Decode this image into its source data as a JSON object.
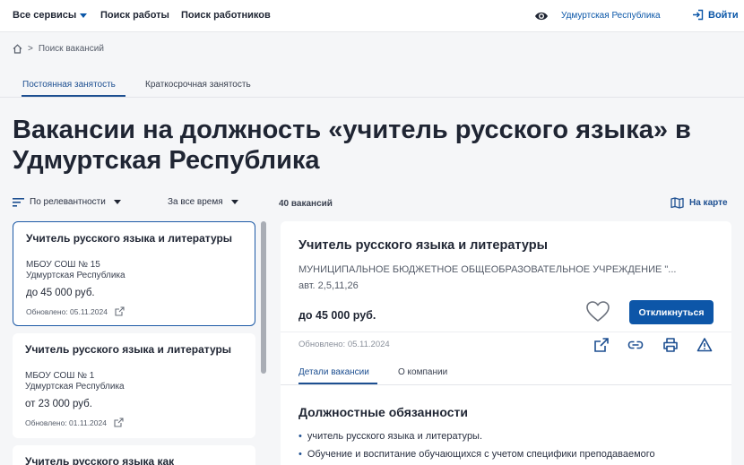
{
  "header": {
    "all_services": "Все сервисы",
    "job_search": "Поиск работы",
    "worker_search": "Поиск работников",
    "region": "Удмуртская Республика",
    "login": "Войти"
  },
  "breadcrumb": {
    "current": "Поиск вакансий"
  },
  "tabs": [
    {
      "label": "Постоянная занятость",
      "active": true
    },
    {
      "label": "Краткосрочная занятость",
      "active": false
    }
  ],
  "page_title": "Вакансии на должность «учитель русского языка» в Удмуртская Республика",
  "filters": {
    "sort": "По релевантности",
    "period": "За все время",
    "count": "40 вакансий",
    "map": "На карте"
  },
  "cards": [
    {
      "title": "Учитель русского языка и литературы",
      "org": "МБОУ СОШ № 15",
      "region": "Удмуртская Республика",
      "salary": "до 45 000 руб.",
      "updated": "Обновлено: 05.11.2024"
    },
    {
      "title": "Учитель русского языка и литературы",
      "org": "МБОУ СОШ № 1",
      "region": "Удмуртская Республика",
      "salary": "от 23 000 руб.",
      "updated": "Обновлено: 01.11.2024"
    },
    {
      "title": "Учитель русского языка как"
    }
  ],
  "detail": {
    "title": "Учитель русского языка и литературы",
    "org": "МУНИЦИПАЛЬНОЕ БЮДЖЕТНОЕ ОБЩЕОБРАЗОВАТЕЛЬНОЕ УЧРЕЖДЕНИЕ \"...",
    "address": "авт. 2,5,11,26",
    "salary": "до 45 000 руб.",
    "apply": "Откликнуться",
    "updated": "Обновлено: 05.11.2024",
    "tabs": [
      {
        "label": "Детали вакансии",
        "active": true
      },
      {
        "label": "О компании",
        "active": false
      }
    ],
    "duties_heading": "Должностные обязанности",
    "duties": [
      "учитель русского языка и литературы.",
      "Обучение и воспитание обучающихся с учетом специфики преподаваемого"
    ]
  },
  "colors": {
    "accent": "#1d4f91",
    "button": "#0d56a8"
  }
}
